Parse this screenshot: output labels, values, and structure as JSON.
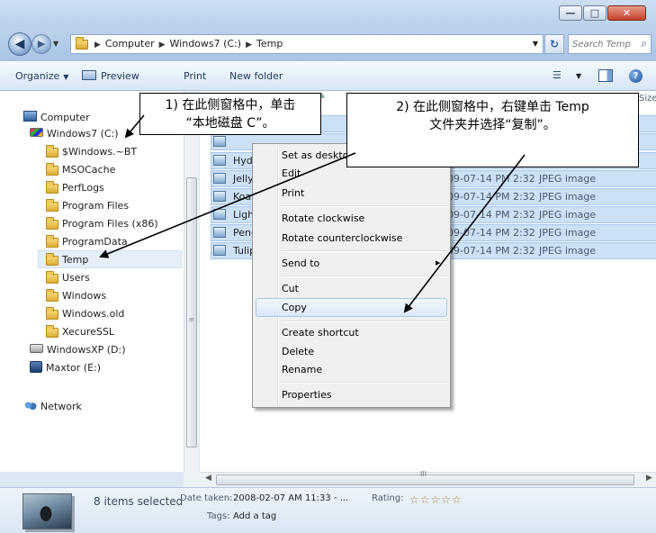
{
  "window": {
    "minimize_glyph": "—",
    "maximize_glyph": "□",
    "close_glyph": "✕"
  },
  "address": {
    "back_glyph": "◀",
    "forward_glyph": "▶",
    "crumbs": [
      "Computer",
      "Windows7 (C:)",
      "Temp"
    ],
    "crumb_sep": "▶",
    "refresh_glyph": "↻",
    "search_placeholder": "Search Temp",
    "search_icon": "magnifier-icon"
  },
  "toolbar": {
    "organize": "Organize",
    "preview": "Preview",
    "print": "Print",
    "new_folder": "New folder",
    "dropdown": "▼"
  },
  "nav": {
    "items": [
      {
        "label": "Computer",
        "icon": "computer-icon"
      },
      {
        "label": "Windows7 (C:)",
        "icon": "windows-drive-icon"
      },
      {
        "label": "$Windows.~BT",
        "icon": "folder-icon"
      },
      {
        "label": "MSOCache",
        "icon": "folder-icon"
      },
      {
        "label": "PerfLogs",
        "icon": "folder-icon"
      },
      {
        "label": "Program Files",
        "icon": "folder-icon"
      },
      {
        "label": "Program Files (x86)",
        "icon": "folder-icon"
      },
      {
        "label": "ProgramData",
        "icon": "folder-icon"
      },
      {
        "label": "Temp",
        "icon": "folder-icon",
        "selected": true
      },
      {
        "label": "Users",
        "icon": "folder-icon"
      },
      {
        "label": "Windows",
        "icon": "folder-icon"
      },
      {
        "label": "Windows.old",
        "icon": "folder-icon"
      },
      {
        "label": "XecureSSL",
        "icon": "folder-icon"
      },
      {
        "label": "WindowsXP (D:)",
        "icon": "drive-icon"
      },
      {
        "label": "Maxtor (E:)",
        "icon": "external-drive-icon"
      },
      {
        "label": "Network",
        "icon": "network-icon"
      }
    ]
  },
  "filelist": {
    "size_header": "Size",
    "rows": [
      {
        "name": "",
        "date": "",
        "type": ""
      },
      {
        "name": "",
        "date": "",
        "type": ""
      },
      {
        "name": "Hyd",
        "date": "",
        "type": ""
      },
      {
        "name": "Jelly",
        "date": "09-07-14 PM 2:32",
        "type": "JPEG image"
      },
      {
        "name": "Koal",
        "date": "09-07-14 PM 2:32",
        "type": "JPEG image"
      },
      {
        "name": "Ligh",
        "date": "09-07-14 PM 2:32",
        "type": "JPEG image"
      },
      {
        "name": "Peng",
        "date": "09-07-14 PM 2:32",
        "type": "JPEG image"
      },
      {
        "name": "Tulip",
        "date": "09-07-14 PM 2:32",
        "type": "JPEG image"
      }
    ]
  },
  "context_menu": {
    "items": [
      "Set as desktop background",
      "Edit",
      "Print",
      "Rotate clockwise",
      "Rotate counterclockwise",
      "Send to",
      "Cut",
      "Copy",
      "Create shortcut",
      "Delete",
      "Rename",
      "Properties"
    ],
    "highlighted": "Copy",
    "submenu_glyph": "▶"
  },
  "details": {
    "selection": "8 items selected",
    "date_label": "Date taken:",
    "date_value": "2008-02-07 AM 11:33 - ...",
    "tags_label": "Tags:",
    "tags_value": "Add a tag",
    "rating_label": "Rating:",
    "rating_stars": "☆☆☆☆☆",
    "rating_value": 0
  },
  "callouts": {
    "c1_line1": "1) 在此侧窗格中，单击",
    "c1_line2": "“本地磁盘 C”。",
    "c2_line1": "2) 在此侧窗格中，右键单击 Temp",
    "c2_line2": "文件夹并选择“复制”。"
  },
  "scroll": {
    "up": "▲",
    "down": "▼",
    "left": "◀",
    "right": "▶",
    "vgrip": "≡",
    "hgrip": "III"
  }
}
